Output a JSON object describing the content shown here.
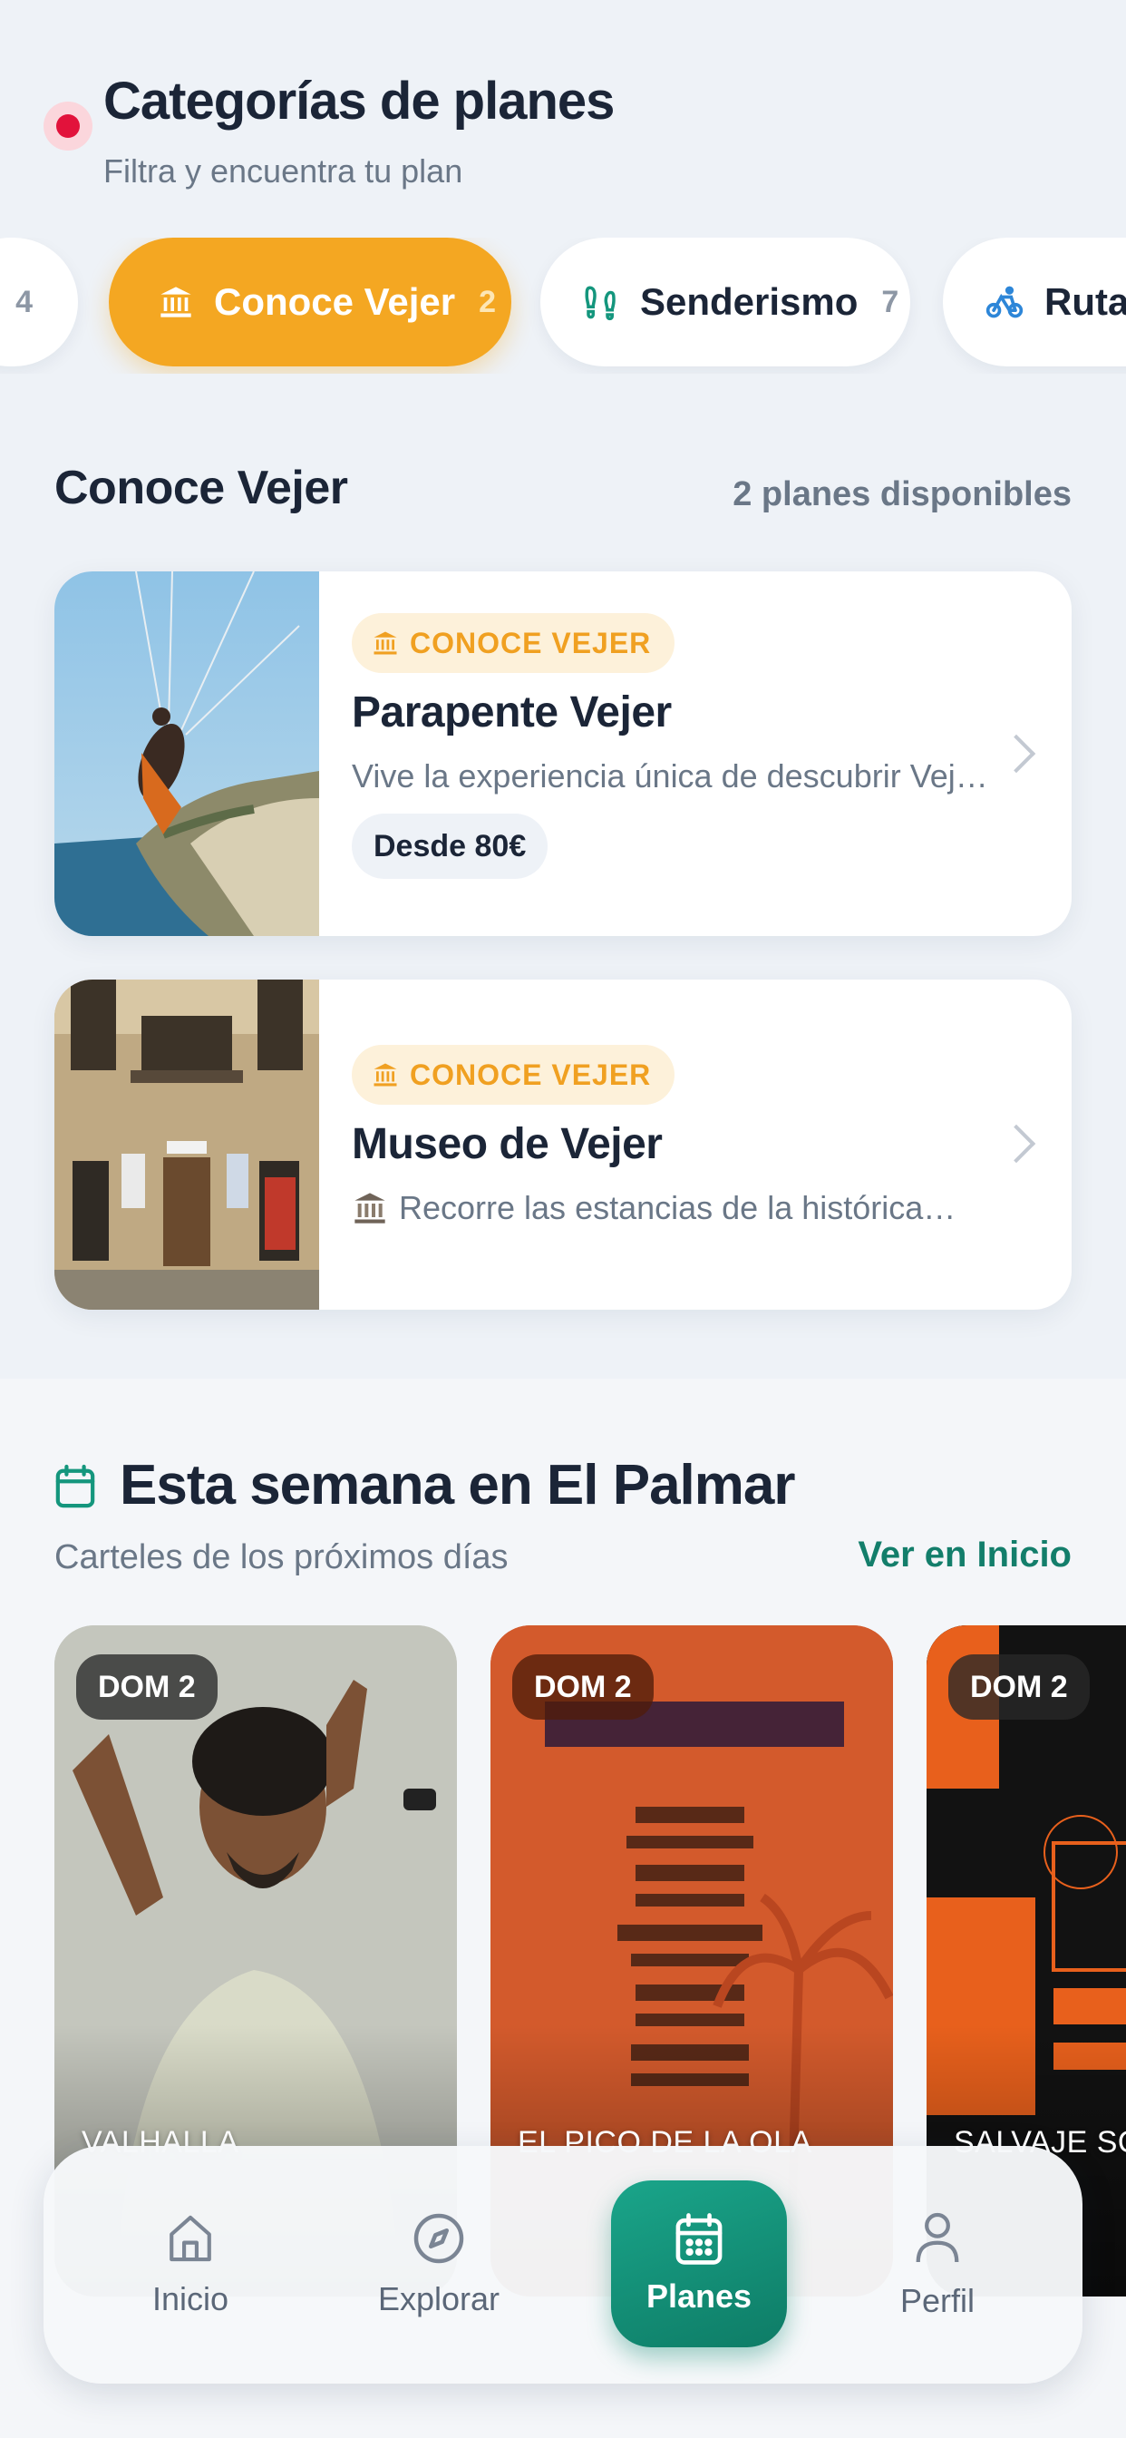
{
  "header": {
    "title": "Categorías de planes",
    "subtitle": "Filtra y encuentra tu plan"
  },
  "categories": [
    {
      "label": "",
      "count": "4",
      "icon": "unknown",
      "active": false
    },
    {
      "label": "Conoce Vejer",
      "count": "2",
      "icon": "museum-icon",
      "active": true
    },
    {
      "label": "Senderismo",
      "count": "7",
      "icon": "footprints-icon",
      "active": false
    },
    {
      "label": "Rutas",
      "count": "",
      "icon": "bike-icon",
      "active": false
    }
  ],
  "section": {
    "title": "Conoce Vejer",
    "count_text": "2 planes disponibles"
  },
  "plans": [
    {
      "badge": "CONOCE VEJER",
      "title": "Parapente Vejer",
      "description": "Vive la experiencia única de descubrir Vejer…",
      "price": "Desde 80€"
    },
    {
      "badge": "CONOCE VEJER",
      "title": "Museo de Vejer",
      "description": "Recorre las estancias de la histórica…",
      "price": ""
    }
  ],
  "week": {
    "title": "Esta semana en El Palmar",
    "subtitle": "Carteles de los próximos días",
    "link": "Ver en Inicio",
    "posters": [
      {
        "date": "DOM 2",
        "venue": "VALHALLA"
      },
      {
        "date": "DOM 2",
        "venue": "EL PICO DE LA OLA"
      },
      {
        "date": "DOM 2",
        "venue": "SALVAJE SOC"
      }
    ]
  },
  "nav": {
    "items": [
      {
        "label": "Inicio",
        "icon": "home-icon"
      },
      {
        "label": "Explorar",
        "icon": "compass-icon"
      },
      {
        "label": "Planes",
        "icon": "calendar-icon",
        "active": true
      },
      {
        "label": "Perfil",
        "icon": "user-icon"
      }
    ]
  },
  "colors": {
    "accent_orange": "#f4a722",
    "accent_green": "#137e6b",
    "text_dark": "#1b2537",
    "text_muted": "#6a7787"
  }
}
